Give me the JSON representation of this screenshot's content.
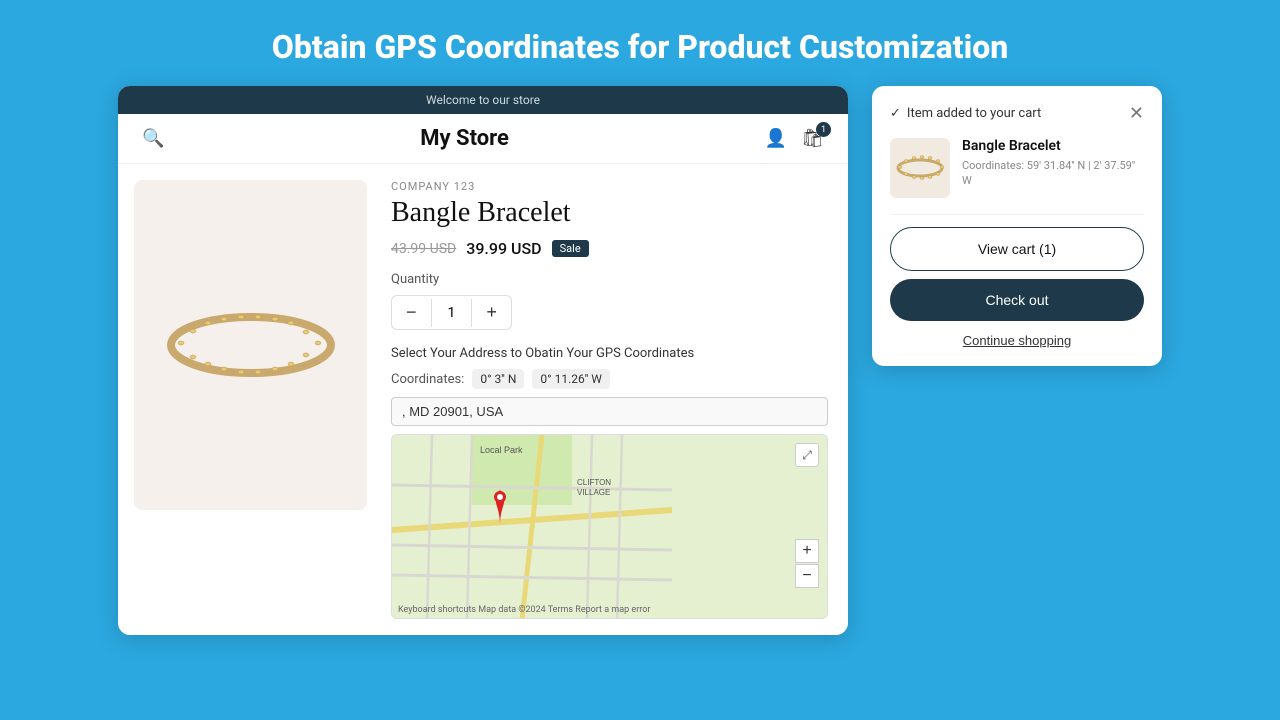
{
  "page": {
    "title": "Obtain GPS Coordinates for Product Customization",
    "background_color": "#2ba8e0"
  },
  "store": {
    "topbar_text": "Welcome to our store",
    "name": "My Store",
    "company": "COMPANY 123",
    "product_title": "Bangle Bracelet",
    "price_original": "43.99 USD",
    "price_sale": "39.99 USD",
    "sale_badge": "Sale",
    "quantity_label": "Quantity",
    "quantity_value": "1",
    "address_section_label": "Select Your Address to Obatin Your GPS Coordinates",
    "coordinates_label": "Coordinates:",
    "coord_lat": "0° 3'' N",
    "coord_lng": "0° 11.26'' W",
    "address_value": ", MD 20901, USA",
    "map_label_local_park": "Local Park",
    "map_label_clifton": "CLIFTON VILLAGE",
    "map_footer": "Keyboard shortcuts  Map data ©2024  Terms  Report a map error"
  },
  "cart_popup": {
    "added_text": "Item added to your cart",
    "item_name": "Bangle Bracelet",
    "item_coords": "Coordinates:  59' 31.84'' N |  2' 37.59'' W",
    "view_cart_label": "View cart (1)",
    "checkout_label": "Check out",
    "continue_label": "Continue shopping"
  },
  "icons": {
    "search": "🔍",
    "user": "👤",
    "cart": "🛍",
    "cart_count": "1",
    "minus": "−",
    "plus": "+",
    "close": "✕",
    "check": "✓",
    "expand": "⤢",
    "zoom_in": "+",
    "zoom_out": "−"
  }
}
